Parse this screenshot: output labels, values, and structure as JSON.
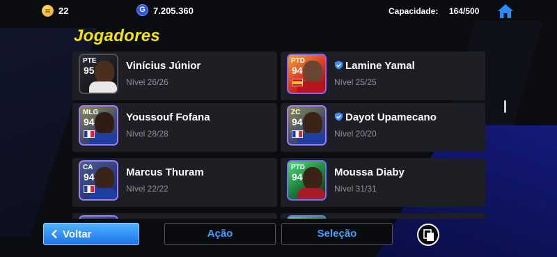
{
  "topbar": {
    "coins": "22",
    "gp": "7.205.360",
    "gp_symbol": "G",
    "capacity_label": "Capacidade:",
    "capacity_value": "164/500"
  },
  "title": "Jogadores",
  "players": [
    {
      "pos": "PTE",
      "ovr": "95",
      "name": "Vinícius Júnior",
      "level": "Nível 26/26",
      "verified": false
    },
    {
      "pos": "PTD",
      "ovr": "94",
      "name": "Lamine Yamal",
      "level": "Nível 25/25",
      "verified": true
    },
    {
      "pos": "MLG",
      "ovr": "94",
      "name": "Youssouf Fofana",
      "level": "Nível 28/28",
      "verified": false
    },
    {
      "pos": "ZC",
      "ovr": "94",
      "name": "Dayot Upamecano",
      "level": "Nível 20/20",
      "verified": true
    },
    {
      "pos": "CA",
      "ovr": "94",
      "name": "Marcus Thuram",
      "level": "Nível 22/22",
      "verified": false
    },
    {
      "pos": "PTD",
      "ovr": "94",
      "name": "Moussa Diaby",
      "level": "Nível 31/31",
      "verified": false
    }
  ],
  "bottombar": {
    "back_label": "Voltar",
    "action_label": "Ação",
    "selection_label": "Seleção"
  },
  "colors": {
    "title": "#f5e600",
    "accent_blue": "#3ea0ff",
    "card_bg": "#1d1f25"
  }
}
